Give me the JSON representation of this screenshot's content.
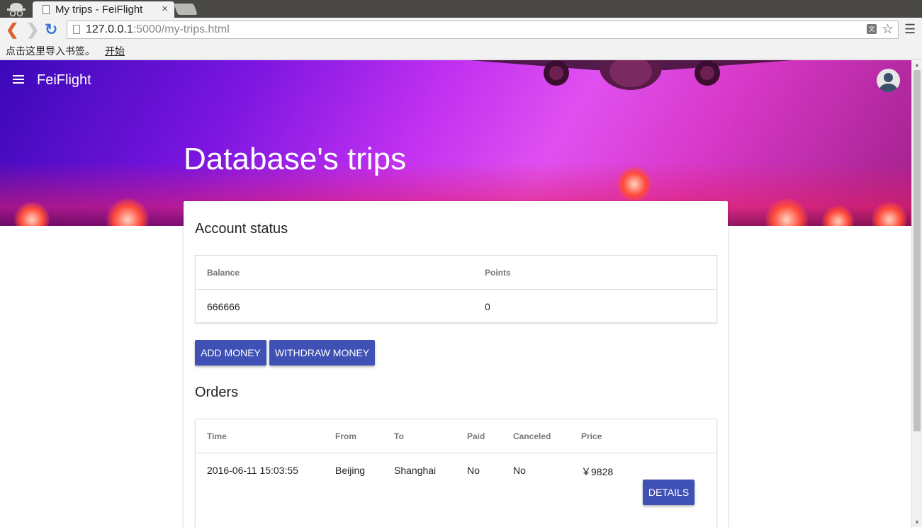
{
  "browser": {
    "tab_title": "My trips - FeiFlight",
    "tab_close": "×",
    "url_host": "127.0.0.1",
    "url_path": ":5000/my-trips.html",
    "bookmarks_prompt": "点击这里导入书签。",
    "bookmarks_link": "开始",
    "icons": [
      "incognito-icon",
      "page-icon",
      "back-icon",
      "forward-icon",
      "reload-icon",
      "translate-icon",
      "star-icon",
      "menu-icon"
    ]
  },
  "app": {
    "brand": "FeiFlight",
    "page_title": "Database's trips"
  },
  "account": {
    "title": "Account status",
    "columns": [
      "Balance",
      "Points"
    ],
    "balance": "666666",
    "points": "0",
    "add_money_label": "ADD MONEY",
    "withdraw_money_label": "WITHDRAW MONEY"
  },
  "orders": {
    "title": "Orders",
    "columns": [
      "Time",
      "From",
      "To",
      "Paid",
      "Canceled",
      "Price"
    ],
    "rows": [
      {
        "time": "2016-06-11 15:03:55",
        "from": "Beijing",
        "to": "Shanghai",
        "paid": "No",
        "canceled": "No",
        "price": "￥9828",
        "details_label": "DETAILS"
      }
    ]
  },
  "colors": {
    "primary_button": "#3f51b5",
    "hero_gradient_start": "#3a08b8",
    "hero_gradient_end": "#e050f0"
  }
}
